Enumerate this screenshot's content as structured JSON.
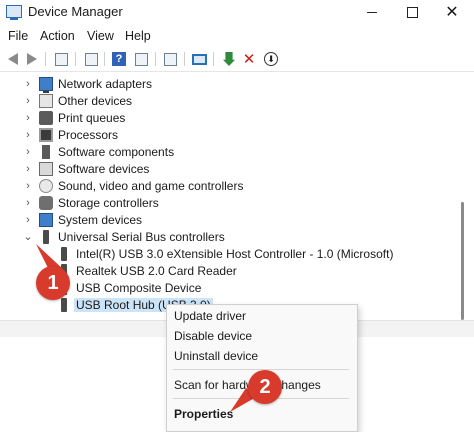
{
  "window": {
    "title": "Device Manager",
    "controls": {
      "minimize": "minimize-icon",
      "maximize": "maximize-icon",
      "close": "✕"
    }
  },
  "menu": [
    "File",
    "Action",
    "View",
    "Help"
  ],
  "toolbar": {
    "icons": [
      "back-arrow-icon",
      "forward-arrow-icon",
      "show-hide-console-tree-icon",
      "properties-icon",
      "help-icon",
      "action-pane-icon",
      "scan-hardware-icon",
      "monitor-icon",
      "update-driver-icon",
      "uninstall-icon",
      "disable-device-icon"
    ]
  },
  "tree": {
    "categories": [
      {
        "label": "Network adapters",
        "icon": "network-adapter-icon"
      },
      {
        "label": "Other devices",
        "icon": "other-devices-icon"
      },
      {
        "label": "Print queues",
        "icon": "printer-icon"
      },
      {
        "label": "Processors",
        "icon": "processor-icon"
      },
      {
        "label": "Software components",
        "icon": "software-component-icon"
      },
      {
        "label": "Software devices",
        "icon": "software-device-icon"
      },
      {
        "label": "Sound, video and game controllers",
        "icon": "sound-icon"
      },
      {
        "label": "Storage controllers",
        "icon": "storage-icon"
      },
      {
        "label": "System devices",
        "icon": "system-device-icon"
      },
      {
        "label": "Universal Serial Bus controllers",
        "icon": "usb-icon",
        "expanded": true
      }
    ],
    "usb_children": [
      "Intel(R) USB 3.0 eXtensible Host Controller - 1.0 (Microsoft)",
      "Realtek USB 2.0 Card Reader",
      "USB Composite Device",
      "USB Root Hub (USB 3.0)"
    ],
    "selected": "USB Root Hub (USB 3.0)"
  },
  "context_menu": {
    "items": [
      "Update driver",
      "Disable device",
      "Uninstall device",
      "Scan for hardware changes",
      "Properties"
    ],
    "default_item": "Properties"
  },
  "annotations": {
    "step1": "1",
    "step2": "2",
    "color": "#d83a2c"
  }
}
